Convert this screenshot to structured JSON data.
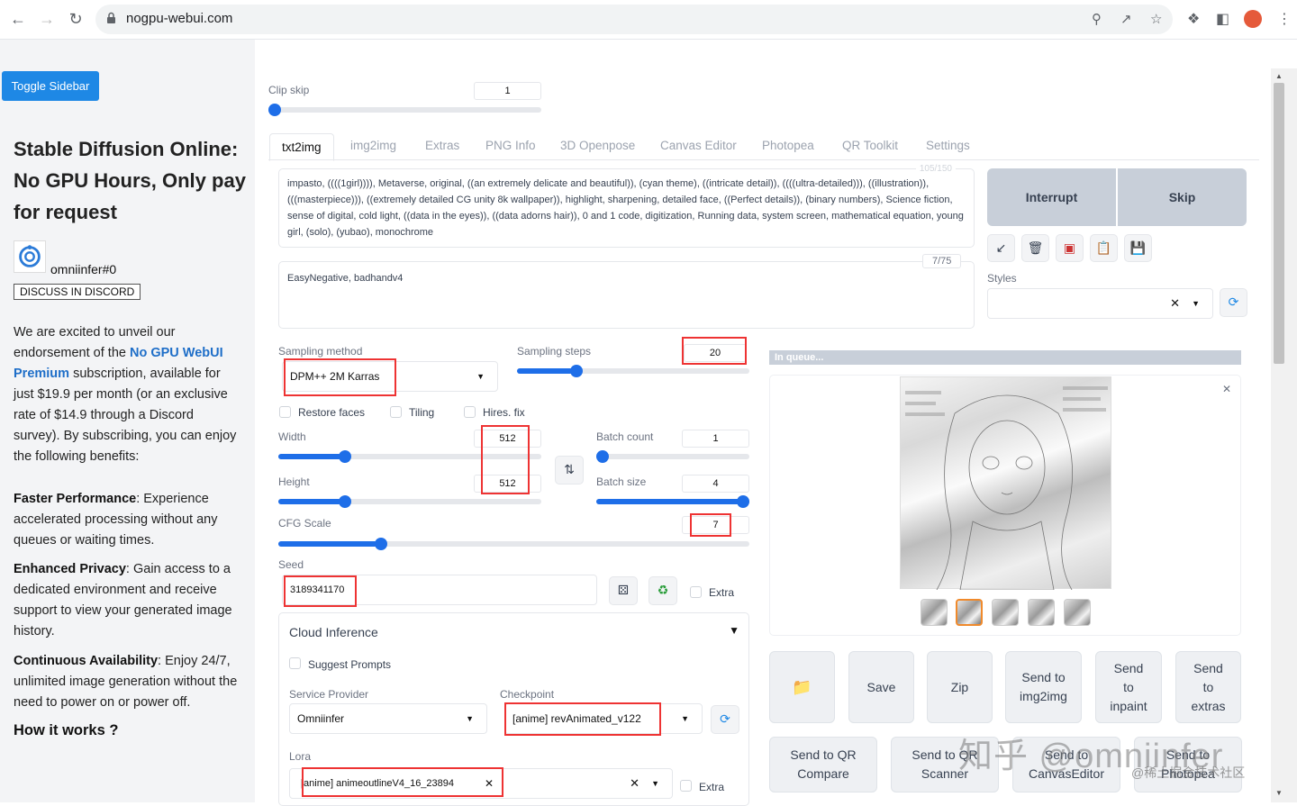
{
  "browser": {
    "url": "nogpu-webui.com"
  },
  "sidebar": {
    "toggle_label": "Toggle Sidebar",
    "title": "Stable Diffusion Online: No GPU Hours, Only pay for request",
    "username": "omniinfer#0",
    "discord_label": "DISCUSS IN DISCORD",
    "intro_1": "We are excited to unveil our endorsement of the ",
    "intro_link": "No GPU WebUI Premium",
    "intro_2": " subscription, available for just $19.9 per month (or an exclusive rate of $14.9 through a Discord survey). By subscribing, you can enjoy the following benefits:",
    "benefits": [
      {
        "title": "Faster Performance",
        "text": ": Experience accelerated processing without any queues or waiting times."
      },
      {
        "title": "Enhanced Privacy",
        "text": ": Gain access to a dedicated environment and receive support to view your generated image history."
      },
      {
        "title": "Continuous Availability",
        "text": ": Enjoy 24/7, unlimited image generation without the need to power on or power off."
      }
    ],
    "how_it_works": "How it works ?"
  },
  "main": {
    "clip_skip": {
      "label": "Clip skip",
      "value": "1"
    },
    "tabs": [
      "txt2img",
      "img2img",
      "Extras",
      "PNG Info",
      "3D Openpose",
      "Canvas Editor",
      "Photopea",
      "QR Toolkit",
      "Settings"
    ],
    "prompt": {
      "counter": "105/150",
      "text": "impasto, ((((1girl)))), Metaverse, original, ((an extremely delicate and beautiful)), (cyan theme), ((intricate detail)), ((((ultra-detailed))), ((illustration)), (((masterpiece))), ((extremely detailed CG unity 8k wallpaper)), highlight, sharpening, detailed face, ((Perfect details)), (binary numbers), Science fiction, sense of digital, cold light, ((data in the eyes)), ((data adorns hair)), 0 and 1 code, digitization, Running data, system screen, mathematical equation, young girl, (solo), (yubao), monochrome"
    },
    "negative_prompt": {
      "counter": "7/75",
      "text": "EasyNegative, badhandv4"
    },
    "actions": {
      "interrupt": "Interrupt",
      "skip": "Skip"
    },
    "styles_label": "Styles",
    "sampling_method": {
      "label": "Sampling method",
      "value": "DPM++ 2M Karras"
    },
    "sampling_steps": {
      "label": "Sampling steps",
      "value": "20",
      "level": 0.24
    },
    "checkboxes": {
      "restore_faces": "Restore faces",
      "tiling": "Tiling",
      "hires_fix": "Hires. fix"
    },
    "width": {
      "label": "Width",
      "value": "512",
      "level": 0.24
    },
    "height": {
      "label": "Height",
      "value": "512",
      "level": 0.24
    },
    "batch_count": {
      "label": "Batch count",
      "value": "1",
      "level": 0.0
    },
    "batch_size": {
      "label": "Batch size",
      "value": "4",
      "level": 1.0
    },
    "cfg_scale": {
      "label": "CFG Scale",
      "value": "7",
      "level": 0.21
    },
    "seed": {
      "label": "Seed",
      "value": "3189341170",
      "extra": "Extra"
    },
    "cloud": {
      "title": "Cloud Inference",
      "suggest": "Suggest Prompts",
      "service_label": "Service Provider",
      "service_value": "Omniinfer",
      "checkpoint_label": "Checkpoint",
      "checkpoint_value": "[anime] revAnimated_v122",
      "lora_label": "Lora",
      "lora_value": "[anime] animeoutlineV4_16_23894",
      "lora_extra": "Extra"
    },
    "output": {
      "status": "In queue...",
      "buttons": {
        "save": "Save",
        "zip": "Zip",
        "send_img2img": "Send to img2img",
        "send_inpaint": "Send to inpaint",
        "send_extras": "Send to extras",
        "qr_compare": "Send to QR Compare",
        "qr_scanner": "Send to QR Scanner",
        "canvas_editor": "Send to CanvasEditor",
        "photopea": "Send to Photopea"
      }
    }
  },
  "watermark": {
    "main": "知乎 @omniinfer",
    "sub": "@稀土掘金技术社区"
  }
}
